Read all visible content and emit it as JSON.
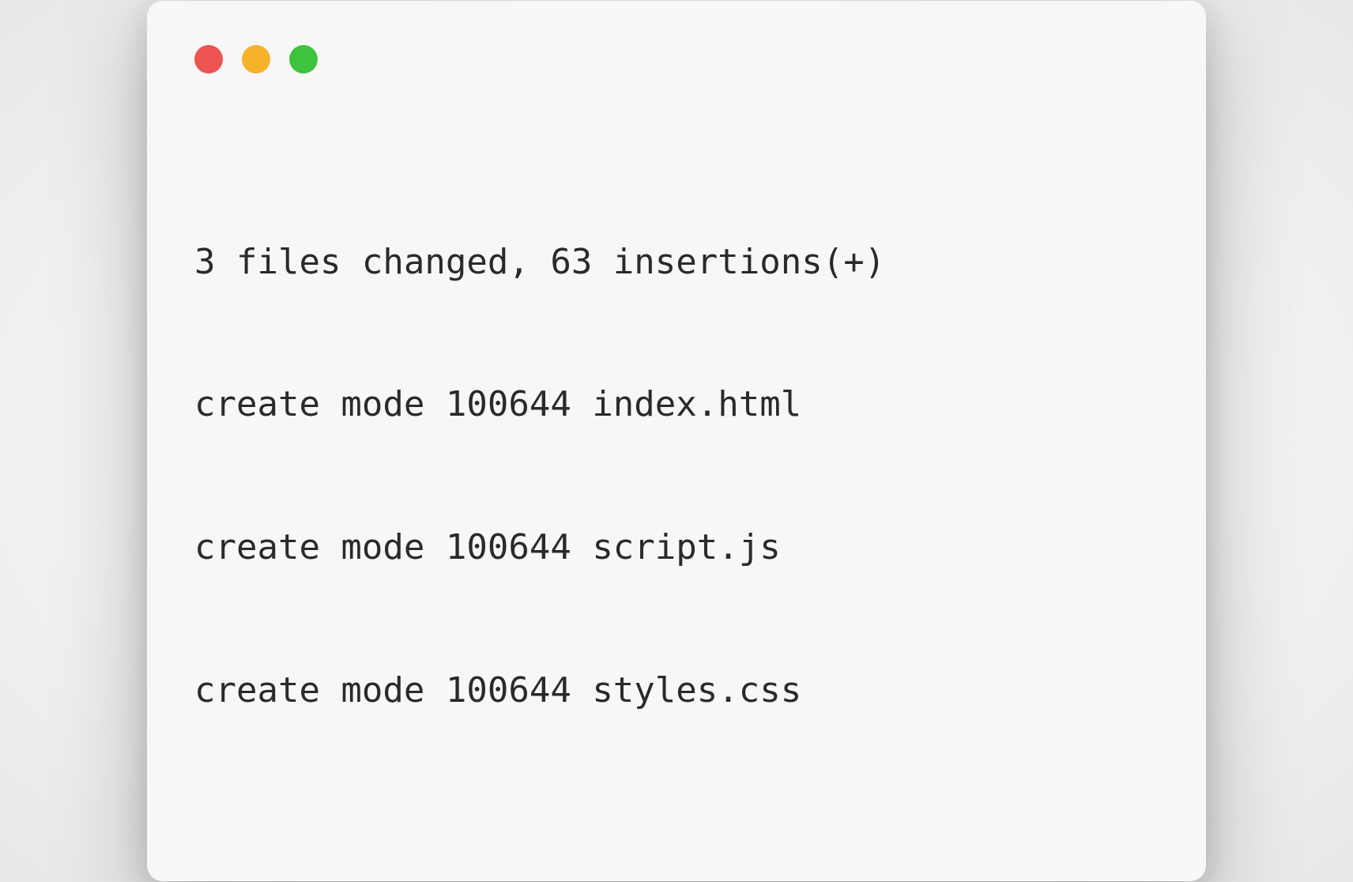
{
  "window": {
    "controls": {
      "close_color": "#ec5550",
      "minimize_color": "#f7b22c",
      "maximize_color": "#3ec33e"
    }
  },
  "terminal": {
    "lines": [
      "3 files changed, 63 insertions(+)",
      "create mode 100644 index.html",
      "create mode 100644 script.js",
      "create mode 100644 styles.css"
    ]
  }
}
